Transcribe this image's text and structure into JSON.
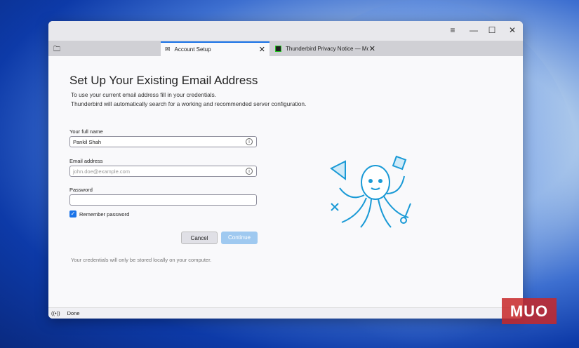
{
  "window": {
    "controls": {
      "menu": "≡",
      "minimize": "—",
      "maximize": "☐",
      "close": "✕"
    }
  },
  "tabs": [
    {
      "label": "Account Setup",
      "icon": "mail-icon",
      "active": true
    },
    {
      "label": "Thunderbird Privacy Notice — Mozi",
      "icon": "web-page-icon",
      "active": false
    }
  ],
  "page": {
    "title": "Set Up Your Existing Email Address",
    "desc_line1": "To use your current email address fill in your credentials.",
    "desc_line2": "Thunderbird will automatically search for a working and recommended server configuration.",
    "name_label": "Your full name",
    "name_value": "Pankil Shah",
    "email_label": "Email address",
    "email_placeholder": "john.doe@example.com",
    "password_label": "Password",
    "password_value": "",
    "remember_label": "Remember password",
    "remember_checked": true,
    "cancel": "Cancel",
    "continue": "Continue",
    "footnote": "Your credentials will only be stored locally on your computer."
  },
  "status": {
    "text": "Done"
  },
  "watermark": "MUO",
  "colors": {
    "accent": "#1a73e8",
    "continue_bg": "#9fc9f0"
  }
}
